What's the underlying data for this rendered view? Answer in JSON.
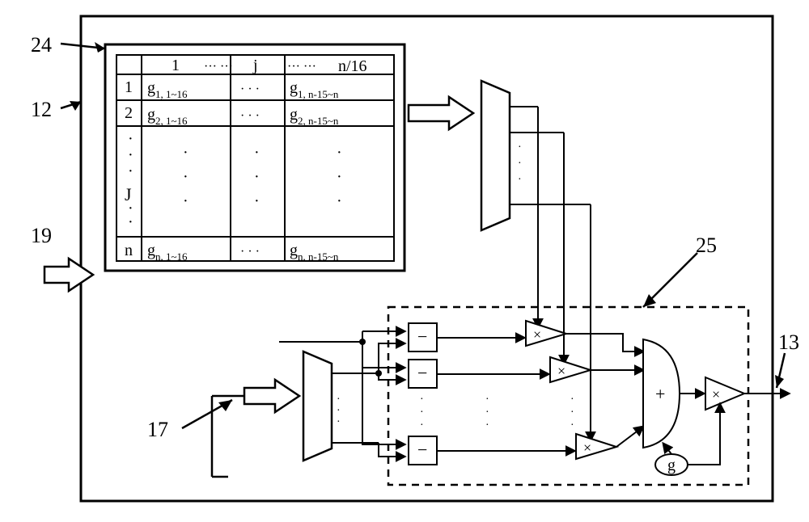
{
  "refs": {
    "r24": "24",
    "r12": "12",
    "r19": "19",
    "r17": "17",
    "r25": "25",
    "r13": "13"
  },
  "table": {
    "col_headers": {
      "c1": "1",
      "c_left_dots": "···  ···",
      "cj": "j",
      "c_right_dots": "···   ···",
      "cn": "n/16"
    },
    "row_labels": {
      "r1": "1",
      "r2": "2",
      "rJ": "J",
      "rn": "n"
    },
    "cells": {
      "g11": "g",
      "g11_sub": "1, 1~16",
      "g1n": "g",
      "g1n_sub": "1, n-15~n",
      "g21": "g",
      "g21_sub": "2, 1~16",
      "g2n": "g",
      "g2n_sub": "2, n-15~n",
      "gn1": "g",
      "gn1_sub": "n, 1~16",
      "gnn": "g",
      "gnn_sub": "n, n-15~n",
      "mid_dots": "· · ·",
      "mid_dots2": "· · ·"
    }
  },
  "blocks": {
    "minus": "−",
    "times": "×",
    "plus": "+",
    "g": "g"
  }
}
